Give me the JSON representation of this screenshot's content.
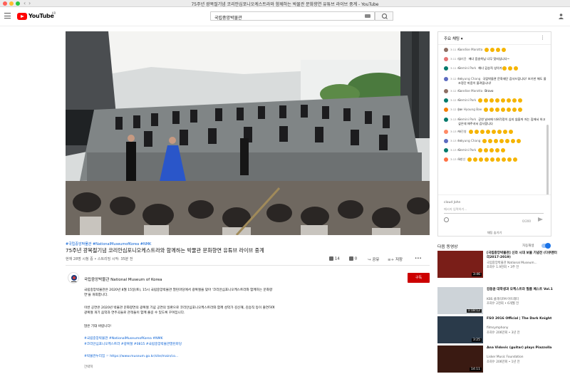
{
  "window": {
    "title": "75주년 광복절기념 코리안심포니오케스트라와 함께하는 박물관 문화향연 유튜브 라이브 중계 - YouTube"
  },
  "header": {
    "logo_text": "YouTube",
    "region": "KR",
    "search_value": "국립중앙박물관"
  },
  "video": {
    "tags": "#국립중앙박물관 #NationalMuseumofKorea #NMK",
    "title": "75주년 광복절기념 코리안심포니오케스트라와 함께하는 박물관 문화향연 유튜브 라이브 중계",
    "meta": "현재 28명 시청 중 • 스트리밍 시작: 35분 전",
    "likes": "14",
    "dislikes": "0",
    "share_label": "공유",
    "save_label": "저장",
    "more_label": "•••"
  },
  "channel": {
    "name": "국립중앙박물관 National Museum of Korea",
    "subscribe_label": "구독"
  },
  "description": {
    "p1": "국립중앙박물관은 2020년 8월 15일(토), 15시 국립중앙박물관 열린마당에서 광복절을 맞아 '코리안심포니오케스트라와 함께하는 문화향연'을 개최합니다.",
    "p2": "이번 공연은 2020년 박물관 문화향연의 광복절 기념 공연의 일환으로 코리안심포니오케스트라와 함께 성악가 김신혜, 김승직 등이 출연하여 광복절 개기 음악과 연주곡들로 관객들이 함께 즐길 수 있도록 꾸며집니다.",
    "p3": "많은 기대 바랍니다!",
    "hashtags1": "#국립중앙박물관 #NationalMuseumofKorea #NMK",
    "hashtags2": "#코리안심포니오케스트라 #광복절 #0815 #국립중앙박물관열린마당",
    "link": "#박물관누리집 ☞ https://www.museum.go.kr/site/main/co...",
    "show_less": "간략히"
  },
  "chat": {
    "title": "주요 채팅 ▾",
    "menu": "⋮",
    "messages": [
      {
        "time": "3:11 PM",
        "author": "Candise Marotta",
        "text": "",
        "emojis": 4,
        "color": "#8d6e63"
      },
      {
        "time": "3:11 PM",
        "author": "김지윤",
        "text": "에너 음송착님 너무 멋지십니다~",
        "emojis": 0,
        "color": "#e57373"
      },
      {
        "time": "3:11 PM",
        "author": "Gemini Park",
        "text": "해너 김승직 성악가",
        "emojis": 3,
        "color": "#00796b"
      },
      {
        "time": "3:12 PM",
        "author": "Inkyung Chang",
        "text": "국립박물관 문화재단 감사드립니다! 보기만 해도 울조정단 마음이 울려옵니다!",
        "emojis": 0,
        "color": "#5c6bc0"
      },
      {
        "time": "3:12 PM",
        "author": "Candise Marotta",
        "text": "Bravo",
        "emojis": 0,
        "color": "#8d6e63"
      },
      {
        "time": "3:12 PM",
        "author": "Gemini Park",
        "text": "",
        "emojis": 8,
        "color": "#00796b"
      },
      {
        "time": "3:12 PM",
        "author": "Jae Hyoung Bae",
        "text": "",
        "emojis": 7,
        "color": "#f57c00"
      },
      {
        "time": "3:13 PM",
        "author": "Gemini Park",
        "text": "공연 날씨에 더위걱정이 심지 않을까 저는 집에서 하고 싶은데 애주셔서 감사합니다",
        "emojis": 0,
        "color": "#00796b"
      },
      {
        "time": "3:13 PM",
        "author": "박진영",
        "text": "",
        "emojis": 8,
        "color": "#ff8a65"
      },
      {
        "time": "3:13 PM",
        "author": "Inkyung Chang",
        "text": "",
        "emojis": 7,
        "color": "#5c6bc0"
      },
      {
        "time": "3:13 PM",
        "author": "Gemini Park",
        "text": "",
        "emojis": 5,
        "color": "#00796b"
      },
      {
        "time": "3:13 PM",
        "author": "1항선",
        "text": "",
        "emojis": 9,
        "color": "#ff7043"
      }
    ],
    "user": "cloud John",
    "input_placeholder": "메시지 입력하기...",
    "counter": "0/200",
    "hide_label": "채팅 숨기기"
  },
  "upnext": {
    "label": "다음 동영상",
    "autoplay_label": "자동재생",
    "items": [
      {
        "title": "[국립중앙박물관] 신라 시대 보물 기념전 (다큐멘터리2017-2019)",
        "channel": "국립중앙박물관 National Museum...",
        "meta": "조회수 1.9천회 • 3주 전",
        "duration": "3:46",
        "bg": "#7a1e18"
      },
      {
        "title": "김동윤 대학생과 오케스트라 필름 페스트 Vol.1",
        "channel": "KBS 클래식FM 아트레터",
        "meta": "조회수 2천회 • 6개월 전",
        "duration": "1:18:12",
        "bg": "#cdd3d8"
      },
      {
        "title": "FSO 2016 Official | The Dark Knight",
        "channel": "filmsymphony",
        "meta": "조회수 206만회 • 3년 전",
        "duration": "3:25",
        "bg": "#2a3a4a"
      },
      {
        "title": "Ana Vidovic (guitar) plays Piazzolla",
        "channel": "Lisker Music Foundation",
        "meta": "조회수 206만회 • 1년 전",
        "duration": "14:11",
        "bg": "#3a1a12"
      }
    ]
  }
}
